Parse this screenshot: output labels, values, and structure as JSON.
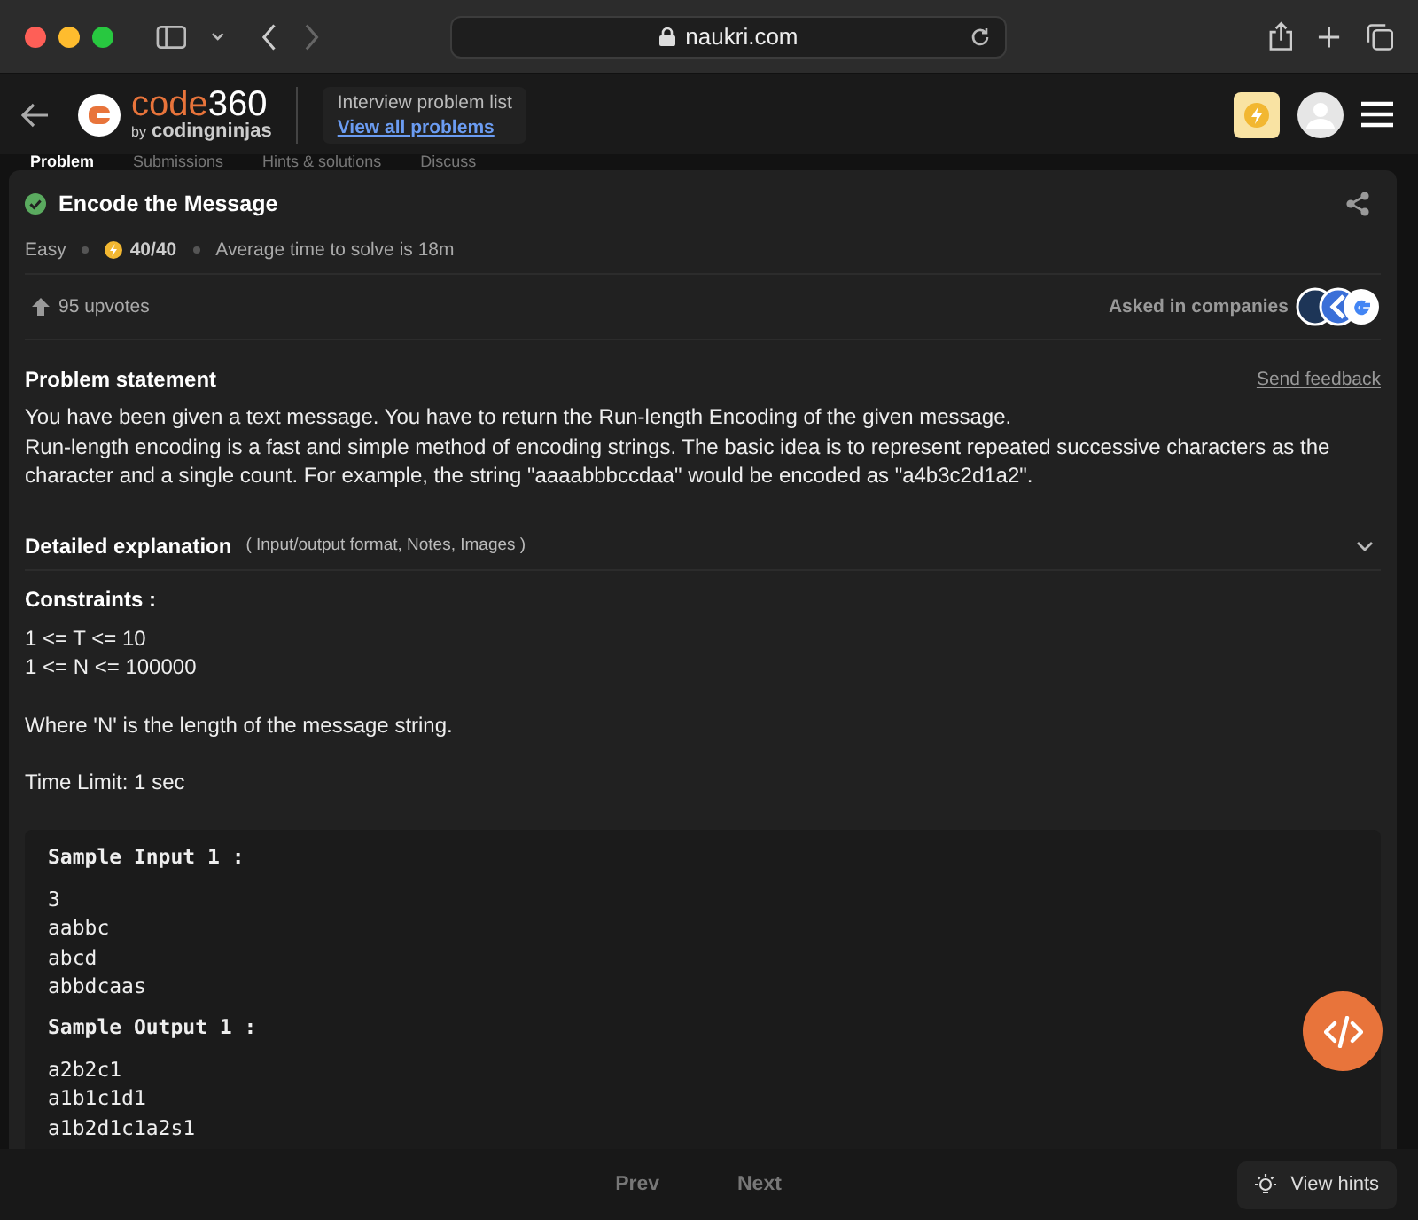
{
  "browser": {
    "url": "naukri.com"
  },
  "header": {
    "logo": {
      "word": "code",
      "number": "360",
      "by": "by",
      "brand": "codingninjas"
    },
    "subtitle": "Interview problem list",
    "link": "View all problems"
  },
  "tabs": [
    {
      "label": "Problem",
      "selected": true
    },
    {
      "label": "Submissions",
      "selected": false
    },
    {
      "label": "Hints & solutions",
      "selected": false
    },
    {
      "label": "Discuss",
      "selected": false
    }
  ],
  "problem": {
    "title": "Encode the Message",
    "solved": true,
    "difficulty": "Easy",
    "score": "40/40",
    "avg_time": "Average time to solve is 18m",
    "upvotes": "95 upvotes",
    "companies_label": "Asked in companies"
  },
  "statement": {
    "heading": "Problem statement",
    "feedback": "Send feedback",
    "paragraphs": [
      "You have been given a text message. You have to return the Run-length Encoding of the given message.",
      "Run-length encoding is a fast and simple method of encoding strings. The basic idea is to represent repeated successive characters as the character and a single count. For example, the string \"aaaabbbccdaa\" would be encoded as \"a4b3c2d1a2\"."
    ]
  },
  "details": {
    "heading": "Detailed explanation",
    "note": "( Input/output format, Notes, Images )",
    "expanded": false
  },
  "constraints": {
    "heading": "Constraints :",
    "lines": [
      "1 <= T <= 10",
      "1 <= N <= 100000"
    ],
    "notes": [
      "Where 'N' is the length of the message string.",
      "Time Limit: 1 sec"
    ]
  },
  "sample": {
    "input_heading": "Sample Input 1 :",
    "input_lines": [
      "3",
      "aabbc",
      "abcd",
      "abbdcaas"
    ],
    "output_heading": "Sample Output 1 :",
    "output_lines": [
      "a2b2c1",
      "a1b1c1d1",
      "a1b2d1c1a2s1"
    ]
  },
  "footer": {
    "prev": "Prev",
    "next": "Next",
    "hints": "View hints"
  }
}
